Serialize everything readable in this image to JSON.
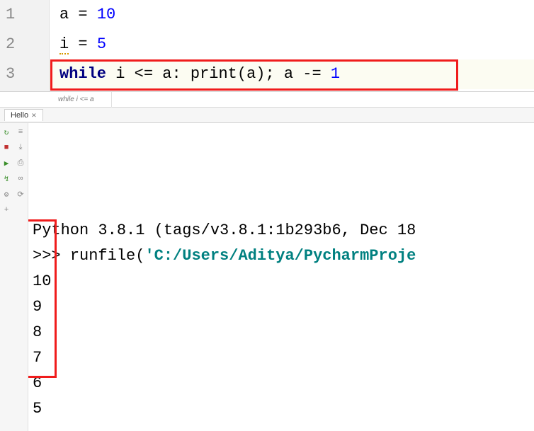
{
  "editor": {
    "lines": [
      {
        "num": "1",
        "tokens": [
          {
            "t": "a",
            "c": "tok-id"
          },
          {
            "t": " "
          },
          {
            "t": "=",
            "c": "tok-op"
          },
          {
            "t": " "
          },
          {
            "t": "10",
            "c": "tok-num"
          }
        ]
      },
      {
        "num": "2",
        "tokens": [
          {
            "t": "i",
            "c": "tok-id",
            "warn": true
          },
          {
            "t": " "
          },
          {
            "t": "=",
            "c": "tok-op"
          },
          {
            "t": " "
          },
          {
            "t": "5",
            "c": "tok-num"
          }
        ]
      },
      {
        "num": "3",
        "hl": true,
        "tokens": [
          {
            "t": "while",
            "c": "tok-kw"
          },
          {
            "t": " "
          },
          {
            "t": "i",
            "c": "tok-id"
          },
          {
            "t": " "
          },
          {
            "t": "<=",
            "c": "tok-op"
          },
          {
            "t": " "
          },
          {
            "t": "a",
            "c": "tok-id"
          },
          {
            "t": ":",
            "c": "tok-op"
          },
          {
            "t": " "
          },
          {
            "t": "print",
            "c": "tok-builtin"
          },
          {
            "t": "(",
            "c": "tok-op"
          },
          {
            "t": "a",
            "c": "tok-id"
          },
          {
            "t": ")",
            "c": "tok-op"
          },
          {
            "t": ";",
            "c": "tok-op"
          },
          {
            "t": " "
          },
          {
            "t": "a",
            "c": "tok-id"
          },
          {
            "t": " "
          },
          {
            "t": "-=",
            "c": "tok-op"
          },
          {
            "t": " "
          },
          {
            "t": "1",
            "c": "tok-num"
          }
        ]
      }
    ]
  },
  "breadcrumb": "while i <= a",
  "tab": {
    "label": "Hello"
  },
  "toolbar_icons": [
    {
      "name": "rerun-icon",
      "glyph": "↻",
      "cls": "tb-green"
    },
    {
      "name": "toggle-soft-wrap-icon",
      "glyph": "≡",
      "cls": "tb-gray"
    },
    {
      "name": "stop-icon",
      "glyph": "■",
      "cls": "tb-red"
    },
    {
      "name": "scroll-to-end-icon",
      "glyph": "⤓",
      "cls": "tb-gray"
    },
    {
      "name": "run-icon",
      "glyph": "▶",
      "cls": "tb-green"
    },
    {
      "name": "print-icon",
      "glyph": "⎙",
      "cls": "tb-gray"
    },
    {
      "name": "attach-icon",
      "glyph": "↯",
      "cls": "tb-green"
    },
    {
      "name": "show-vars-icon",
      "glyph": "∞",
      "cls": "tb-gray"
    },
    {
      "name": "settings-icon",
      "glyph": "⚙",
      "cls": "tb-gray"
    },
    {
      "name": "history-icon",
      "glyph": "⟳",
      "cls": "tb-gray"
    },
    {
      "name": "add-icon",
      "glyph": "+",
      "cls": "tb-gray"
    }
  ],
  "console": {
    "banner": "Python 3.8.1 (tags/v3.8.1:1b293b6, Dec 18",
    "prompt": ">>> ",
    "cmd_prefix": "runfile(",
    "cmd_str": "'C:/Users/Aditya/PycharmProje",
    "output": [
      "10",
      "9",
      "8",
      "7",
      "6",
      "5"
    ]
  }
}
